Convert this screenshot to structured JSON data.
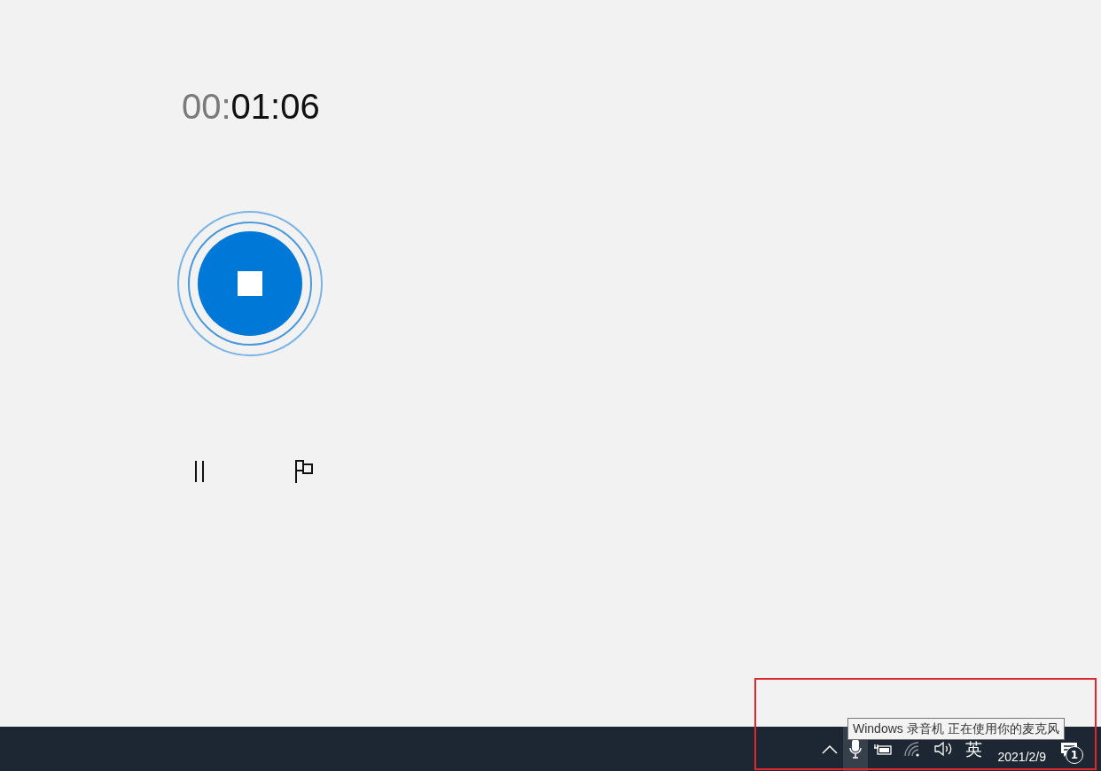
{
  "timer": {
    "hours": "00:",
    "rest": "01:06"
  },
  "recorder": {
    "recording": true
  },
  "tray": {
    "mic_selected": true,
    "ime": "英",
    "date": "2021/2/9",
    "notifications": "1"
  },
  "tooltip": {
    "text": "Windows 录音机 正在使用你的麦克风"
  },
  "highlight": {
    "shown": true
  }
}
